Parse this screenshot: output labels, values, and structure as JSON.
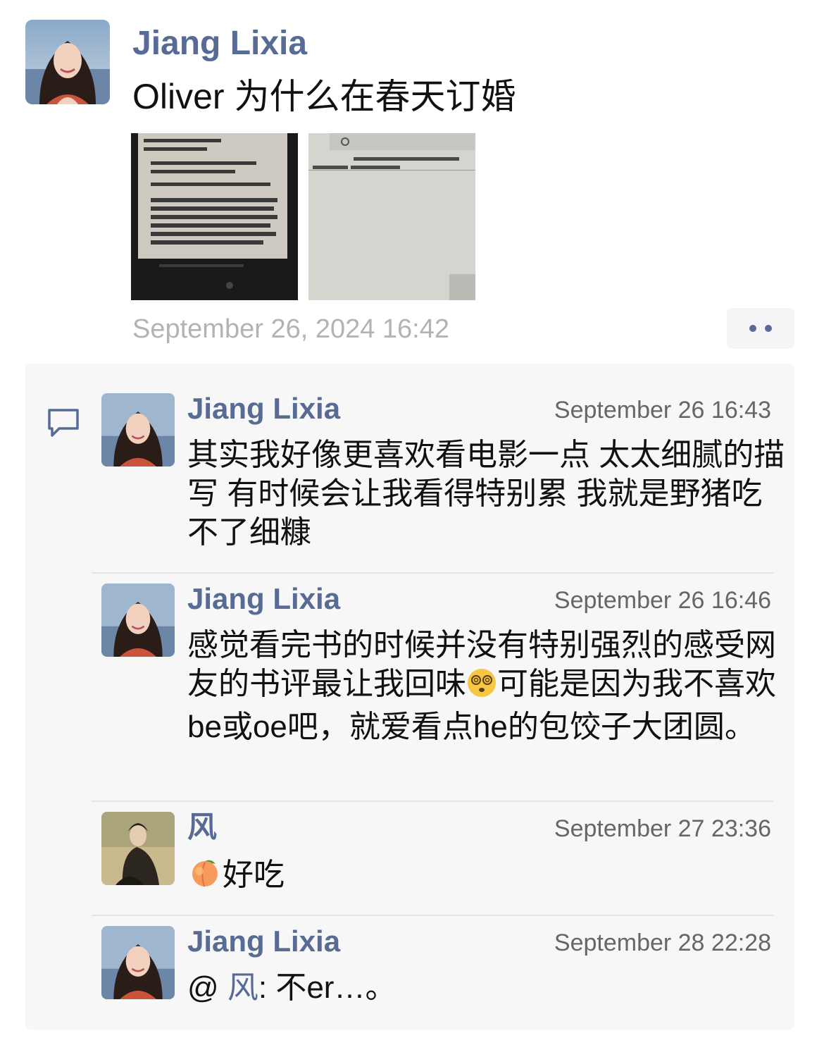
{
  "post": {
    "author": "Jiang Lixia",
    "text": "Oliver  为什么在春天订婚",
    "timestamp": "September 26, 2024 16:42",
    "images": [
      {
        "type": "photo",
        "subject": "e-reader-text-page"
      },
      {
        "type": "photo",
        "subject": "e-reader-blank-page"
      }
    ],
    "more_icon": "ellipsis-icon"
  },
  "comments": [
    {
      "author": "Jiang Lixia",
      "time": "September 26 16:43",
      "text": "其实我好像更喜欢看电影一点  太太细腻的描写  有时候会让我看得特别累  我就是野猪吃不了细糠"
    },
    {
      "author": "Jiang Lixia",
      "time": "September 26 16:46",
      "text_before_emoji": "感觉看完书的时候并没有特别强烈的感受网友的书评最让我回味",
      "emoji": "dizzy-face-emoji",
      "text_after_emoji": "可能是因为我不喜欢be或oe吧，就爱看点he的包饺子大团圆。"
    },
    {
      "author": "风",
      "time": "September 27 23:36",
      "emoji": "peach-emoji",
      "text": "好吃"
    },
    {
      "author": "Jiang Lixia",
      "time": "September 28 22:28",
      "mention_prefix": "@ ",
      "mention": "风",
      "text": ": 不er…。"
    }
  ],
  "colors": {
    "link": "#576b95",
    "panel": "#f7f7f7",
    "timestamp": "#b3b3b3"
  }
}
